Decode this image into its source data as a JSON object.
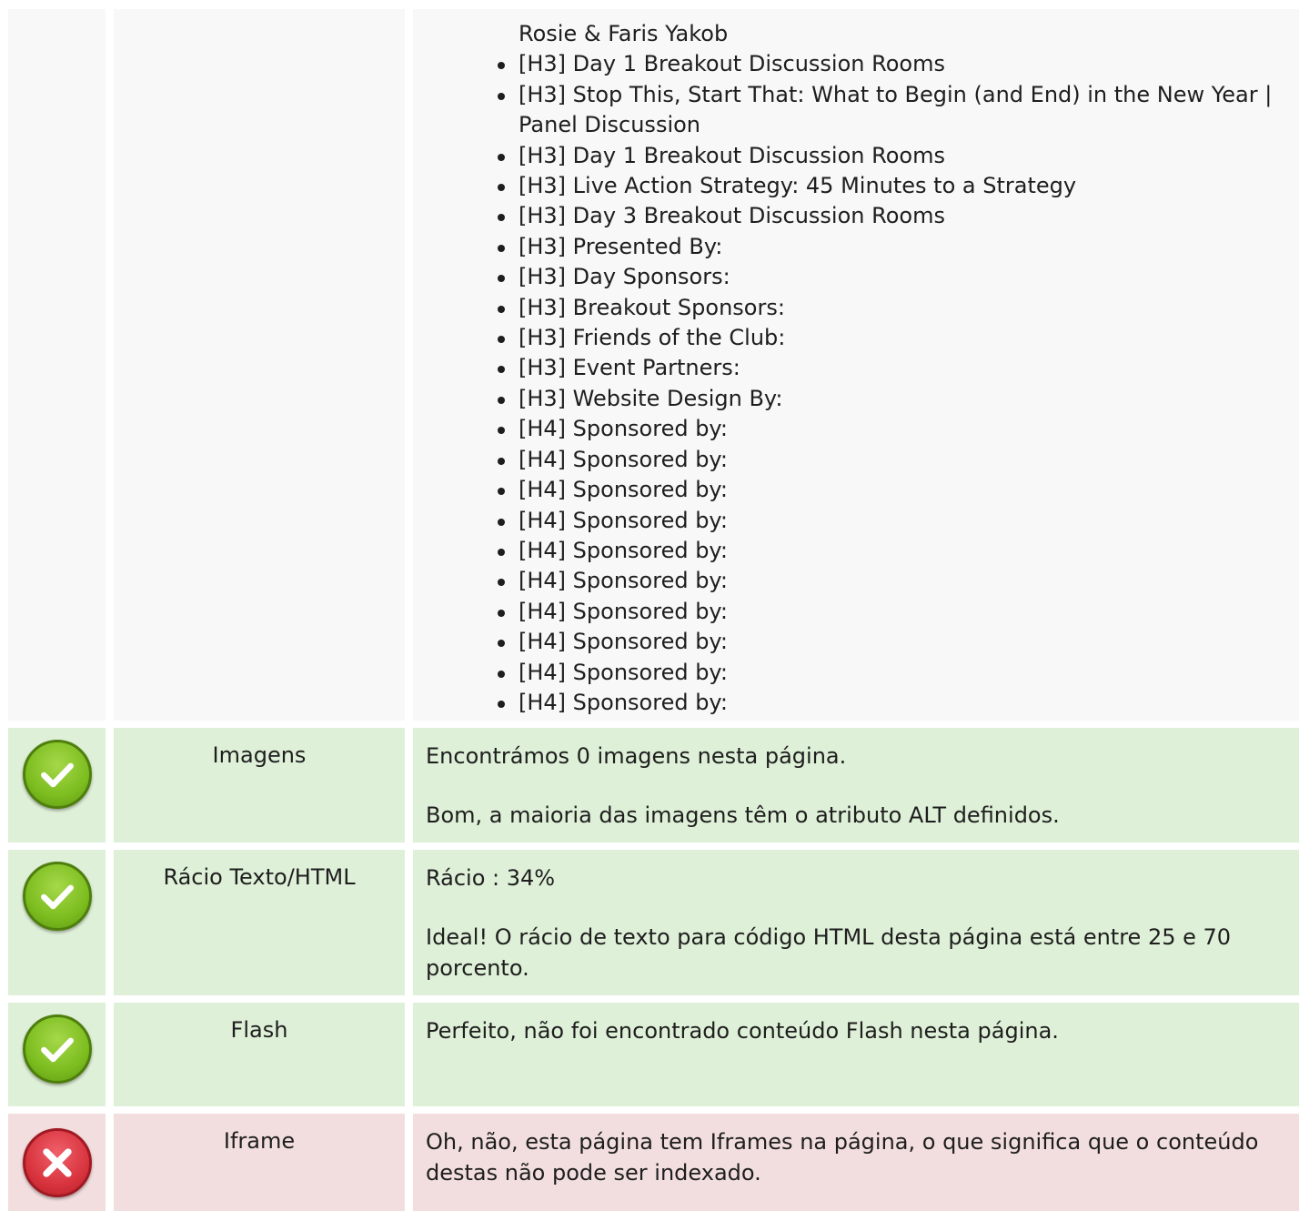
{
  "headings_list": {
    "continuation": "Rosie & Faris Yakob",
    "items": [
      "[H3] Day 1 Breakout Discussion Rooms",
      "[H3] Stop This, Start That: What to Begin (and End) in the New Year | Panel Discussion",
      "[H3] Day 1 Breakout Discussion Rooms",
      "[H3] Live Action Strategy: 45 Minutes to a Strategy",
      "[H3] Day 3 Breakout Discussion Rooms",
      "[H3] Presented By:",
      "[H3] Day Sponsors:",
      "[H3] Breakout Sponsors:",
      "[H3] Friends of the Club:",
      "[H3] Event Partners:",
      "[H3] Website Design By:",
      "[H4] Sponsored by:",
      "[H4] Sponsored by:",
      "[H4] Sponsored by:",
      "[H4] Sponsored by:",
      "[H4] Sponsored by:",
      "[H4] Sponsored by:",
      "[H4] Sponsored by:",
      "[H4] Sponsored by:",
      "[H4] Sponsored by:",
      "[H4] Sponsored by:"
    ]
  },
  "checks": [
    {
      "status": "ok",
      "icon": "check-icon",
      "label": "Imagens",
      "lines": [
        "Encontrámos 0 imagens nesta página.",
        "Bom, a maioria das imagens têm o atributo ALT definidos."
      ]
    },
    {
      "status": "ok",
      "icon": "check-icon",
      "label": "Rácio Texto/HTML",
      "lines": [
        "Rácio : 34%",
        "Ideal! O rácio de texto para código HTML desta página está entre 25 e 70 porcento."
      ]
    },
    {
      "status": "ok",
      "icon": "check-icon",
      "label": "Flash",
      "lines": [
        "Perfeito, não foi encontrado conteúdo Flash nesta página."
      ]
    },
    {
      "status": "bad",
      "icon": "cross-icon",
      "label": "Iframe",
      "lines": [
        "Oh, não, esta página tem Iframes na página, o que significa que o conteúdo destas não pode ser indexado."
      ]
    }
  ],
  "colors": {
    "ok_row": "#dff0d8",
    "bad_row": "#f2dede",
    "neutral_row": "#f8f8f8",
    "ok_icon": "#7cbd1f",
    "bad_icon": "#d8343e"
  }
}
